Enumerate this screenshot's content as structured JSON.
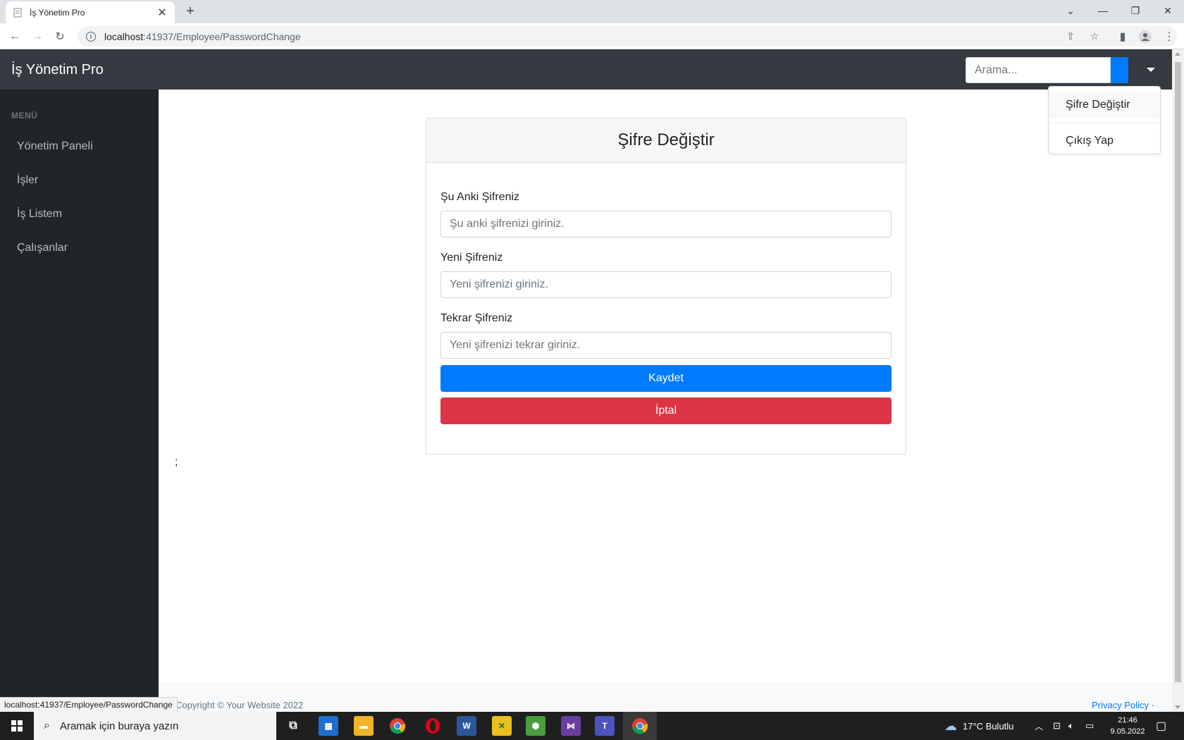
{
  "browser": {
    "tab_title": "İş Yönetim Pro",
    "url_host": "localhost",
    "url_path": ":41937/Employee/PasswordChange",
    "status_url": "localhost:41937/Employee/PasswordChange"
  },
  "header": {
    "brand": "İş Yönetim Pro",
    "search_placeholder": "Arama..."
  },
  "user_menu": {
    "items": [
      {
        "label": "Şifre Değiştir"
      },
      {
        "label": "Çıkış Yap"
      }
    ]
  },
  "sidebar": {
    "heading": "MENÜ",
    "items": [
      {
        "label": "Yönetim Paneli"
      },
      {
        "label": "İşler"
      },
      {
        "label": "İş Listem"
      },
      {
        "label": "Çalışanlar"
      }
    ]
  },
  "form": {
    "title": "Şifre Değiştir",
    "current_label": "Şu Anki Şifreniz",
    "current_placeholder": "Şu anki şifrenizi giriniz.",
    "new_label": "Yeni Şifreniz",
    "new_placeholder": "Yeni şifrenizi giriniz.",
    "repeat_label": "Tekrar Şifreniz",
    "repeat_placeholder": "Yeni şifrenizi tekrar giriniz.",
    "save_label": "Kaydet",
    "cancel_label": "İptal"
  },
  "stray_text": ";",
  "footer": {
    "copyright": "Copyright © Your Website 2022",
    "privacy": "Privacy Policy ·"
  },
  "taskbar": {
    "search_placeholder": "Aramak için buraya yazın",
    "weather": "17°C  Bulutlu",
    "time": "21:46",
    "date": "9.05.2022"
  },
  "colors": {
    "primary": "#007bff",
    "danger": "#dc3545",
    "header_bg": "#343a40",
    "sidebar_bg": "#212529"
  }
}
